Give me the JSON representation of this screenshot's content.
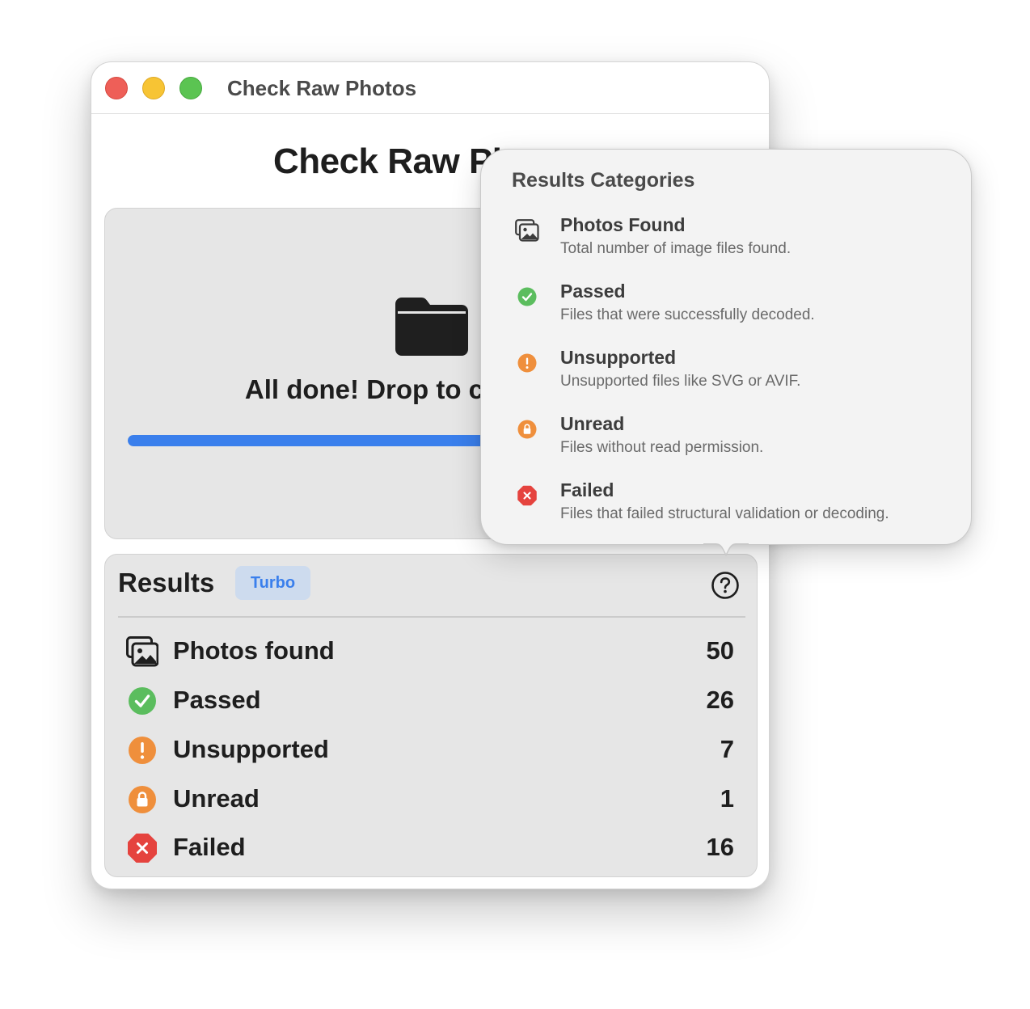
{
  "window": {
    "title": "Check Raw Photos"
  },
  "app": {
    "heading": "Check Raw Photos"
  },
  "drop_zone": {
    "icon": "folder-icon",
    "status_text": "All done! Drop to check more",
    "progress_fraction": 1.0,
    "progress_color": "#3a7fec"
  },
  "results": {
    "title": "Results",
    "mode_badge": "Turbo",
    "help_icon": "question-circle-icon",
    "rows": [
      {
        "label": "Photos found",
        "value": "50",
        "icon": "photos-stack-icon"
      },
      {
        "label": "Passed",
        "value": "26",
        "icon": "checkmark-circle-icon",
        "color": "#5bbd5e"
      },
      {
        "label": "Unsupported",
        "value": "7",
        "icon": "exclamation-circle-icon",
        "color": "#ef8f3c"
      },
      {
        "label": "Unread",
        "value": "1",
        "icon": "lock-circle-icon",
        "color": "#ef8f3c"
      },
      {
        "label": "Failed",
        "value": "16",
        "icon": "xmark-octagon-icon",
        "color": "#e5433e"
      }
    ]
  },
  "popover": {
    "title": "Results Categories",
    "categories": [
      {
        "name": "Photos Found",
        "description": "Total number of image files found.",
        "icon": "photos-stack-icon"
      },
      {
        "name": "Passed",
        "description": "Files that were successfully decoded.",
        "icon": "checkmark-circle-icon"
      },
      {
        "name": "Unsupported",
        "description": "Unsupported files like SVG or AVIF.",
        "icon": "exclamation-circle-icon"
      },
      {
        "name": "Unread",
        "description": "Files without read permission.",
        "icon": "lock-circle-icon"
      },
      {
        "name": "Failed",
        "description": "Files that failed structural validation or decoding.",
        "icon": "xmark-octagon-icon"
      }
    ]
  }
}
